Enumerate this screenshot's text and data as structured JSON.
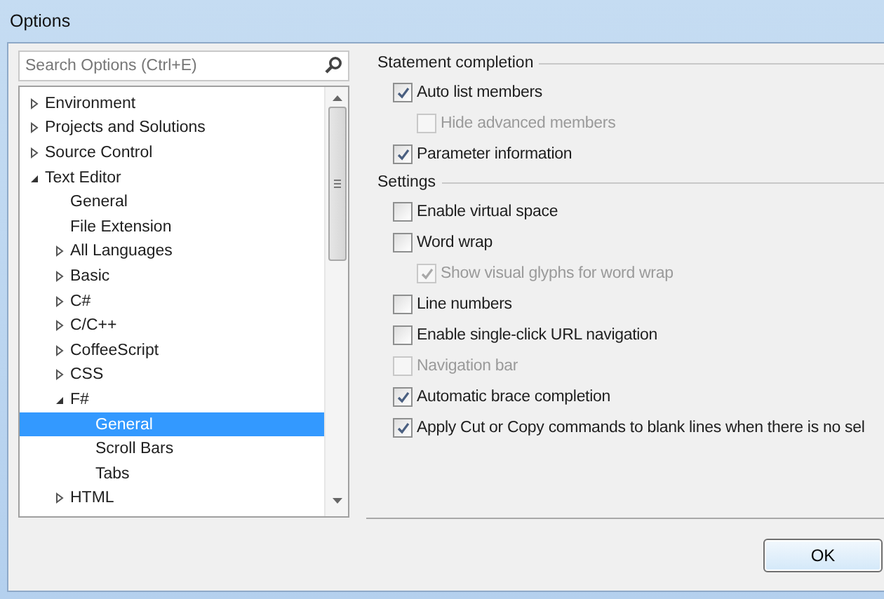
{
  "window": {
    "title": "Options"
  },
  "search": {
    "placeholder": "Search Options (Ctrl+E)"
  },
  "tree": [
    {
      "label": "Environment",
      "expanded": false,
      "selected": false
    },
    {
      "label": "Projects and Solutions",
      "expanded": false,
      "selected": false
    },
    {
      "label": "Source Control",
      "expanded": false,
      "selected": false
    },
    {
      "label": "Text Editor",
      "expanded": true,
      "selected": false,
      "children": [
        {
          "label": "General",
          "selected": false
        },
        {
          "label": "File Extension",
          "selected": false
        },
        {
          "label": "All Languages",
          "expanded": false,
          "selected": false
        },
        {
          "label": "Basic",
          "expanded": false,
          "selected": false
        },
        {
          "label": "C#",
          "expanded": false,
          "selected": false
        },
        {
          "label": "C/C++",
          "expanded": false,
          "selected": false
        },
        {
          "label": "CoffeeScript",
          "expanded": false,
          "selected": false
        },
        {
          "label": "CSS",
          "expanded": false,
          "selected": false
        },
        {
          "label": "F#",
          "expanded": true,
          "selected": false,
          "children": [
            {
              "label": "General",
              "selected": true
            },
            {
              "label": "Scroll Bars",
              "selected": false
            },
            {
              "label": "Tabs",
              "selected": false
            }
          ]
        },
        {
          "label": "HTML",
          "expanded": false,
          "selected": false
        }
      ]
    }
  ],
  "groups": [
    {
      "title": "Statement completion",
      "options": [
        {
          "label": "Auto list members",
          "checked": true,
          "disabled": false,
          "children": [
            {
              "label": "Hide advanced members",
              "checked": false,
              "disabled": true
            }
          ]
        },
        {
          "label": "Parameter information",
          "checked": true,
          "disabled": false
        }
      ]
    },
    {
      "title": "Settings",
      "options": [
        {
          "label": "Enable virtual space",
          "checked": false,
          "disabled": false
        },
        {
          "label": "Word wrap",
          "checked": false,
          "disabled": false,
          "children": [
            {
              "label": "Show visual glyphs for word wrap",
              "checked": true,
              "disabled": true
            }
          ]
        },
        {
          "label": "Line numbers",
          "checked": false,
          "disabled": false
        },
        {
          "label": "Enable single-click URL navigation",
          "checked": false,
          "disabled": false
        },
        {
          "label": "Navigation bar",
          "checked": false,
          "disabled": true
        },
        {
          "label": "Automatic brace completion",
          "checked": true,
          "disabled": false
        },
        {
          "label": "Apply Cut or Copy commands to blank lines when there is no sel",
          "checked": true,
          "disabled": false
        }
      ]
    }
  ],
  "buttons": [
    "OK"
  ]
}
